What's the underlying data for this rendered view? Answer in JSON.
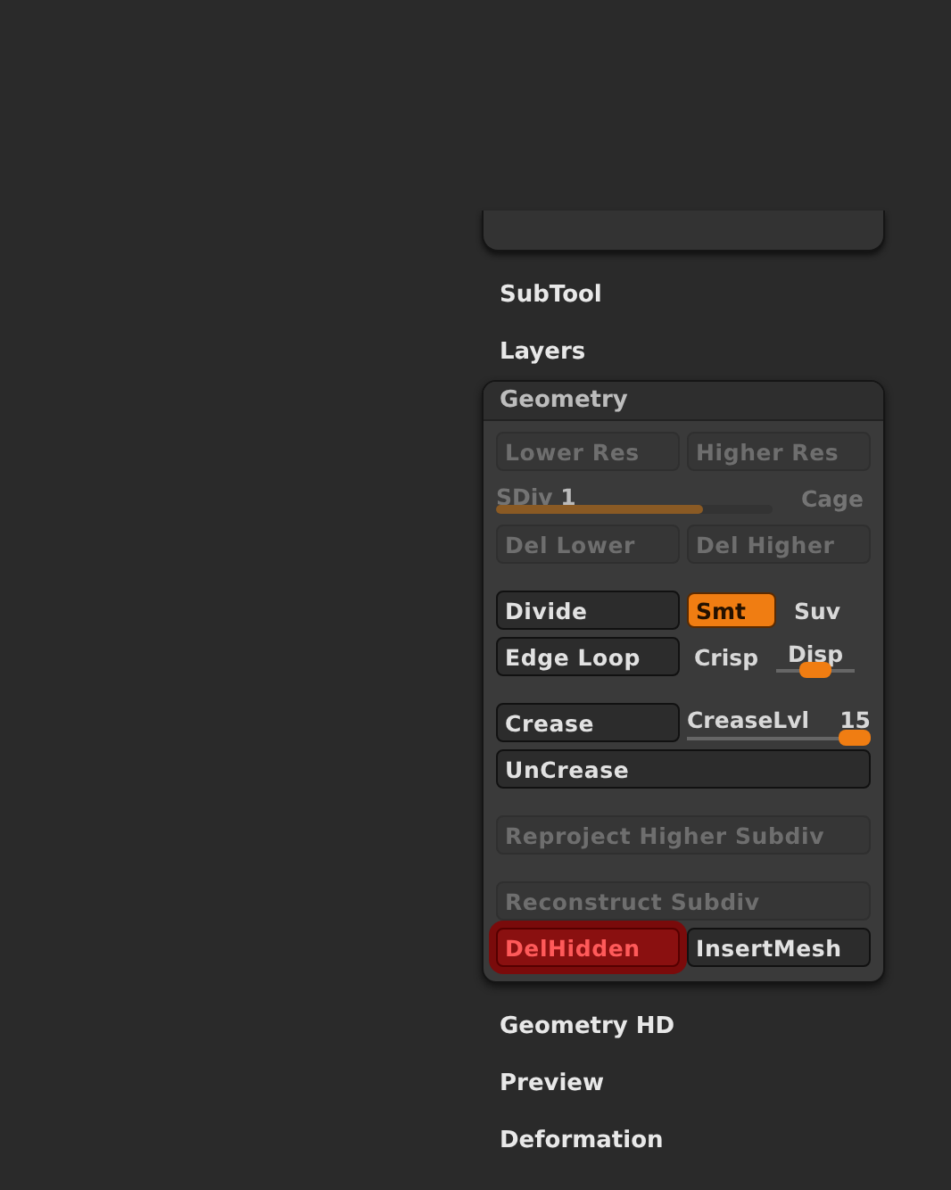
{
  "palettes_above": [
    {
      "title": "SubTool"
    },
    {
      "title": "Layers"
    }
  ],
  "geometry": {
    "title": "Geometry",
    "groups": [
      [
        {
          "items": [
            {
              "kind": "button",
              "label": "Lower Res",
              "disabled": true
            },
            {
              "kind": "button",
              "label": "Higher Res",
              "disabled": true
            }
          ]
        },
        {
          "items": [
            {
              "kind": "slider",
              "label": "SDiv",
              "value": "1",
              "level": 0.75,
              "disabled": true
            },
            {
              "kind": "label",
              "label": "Cage",
              "disabled": true
            }
          ]
        },
        {
          "items": [
            {
              "kind": "button",
              "label": "Del Lower",
              "disabled": true
            },
            {
              "kind": "button",
              "label": "Del Higher",
              "disabled": true
            }
          ]
        }
      ],
      [
        {
          "items": [
            {
              "kind": "button",
              "label": "Divide",
              "disabled": false
            },
            {
              "kind": "toggle",
              "label": "Smt",
              "on": true
            },
            {
              "kind": "toggle",
              "label": "Suv",
              "on": false
            }
          ]
        },
        {
          "items": [
            {
              "kind": "button",
              "label": "Edge Loop",
              "disabled": false
            },
            {
              "kind": "toggle",
              "label": "Crisp",
              "on": false
            },
            {
              "kind": "mini_slider",
              "label": "Disp",
              "level": 0.5
            }
          ]
        }
      ],
      [
        {
          "items": [
            {
              "kind": "button",
              "label": "Crease",
              "disabled": false
            },
            {
              "kind": "slider_below",
              "label": "CreaseLvl",
              "value": "15",
              "level": 1
            }
          ]
        },
        {
          "items": [
            {
              "kind": "wide_button",
              "label": "UnCrease",
              "disabled": false
            }
          ]
        }
      ],
      [
        {
          "items": [
            {
              "kind": "wide_button",
              "label": "Reproject Higher Subdiv",
              "disabled": true
            }
          ]
        }
      ],
      [
        {
          "items": [
            {
              "kind": "wide_button",
              "label": "Reconstruct Subdiv",
              "disabled": true
            }
          ]
        },
        {
          "items": [
            {
              "kind": "button",
              "label": "DelHidden",
              "disabled": false,
              "highlighted": true
            },
            {
              "kind": "button",
              "label": "InsertMesh",
              "disabled": false,
              "highlighted": false
            }
          ]
        }
      ]
    ]
  },
  "palettes_below": [
    {
      "title": "Geometry HD"
    },
    {
      "title": "Preview"
    },
    {
      "title": "Deformation"
    }
  ]
}
